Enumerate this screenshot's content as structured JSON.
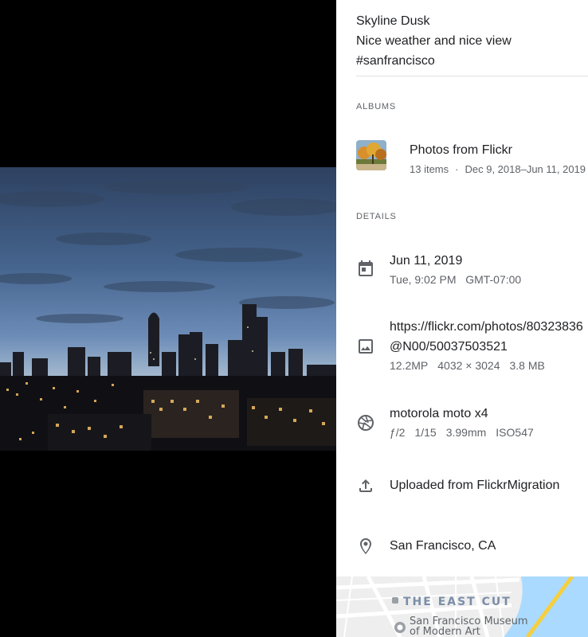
{
  "description": {
    "title": "Skyline Dusk",
    "caption": "Nice weather and nice view",
    "tags": "#sanfrancisco"
  },
  "albums": {
    "heading": "ALBUMS",
    "items": [
      {
        "title": "Photos from Flickr",
        "count": "13 items",
        "date_range": "Dec 9, 2018–Jun 11, 2019"
      }
    ]
  },
  "details": {
    "heading": "DETAILS",
    "date": {
      "icon": "calendar-icon",
      "primary": "Jun 11, 2019",
      "secondary": "Tue, 9:02 PM   GMT-07:00"
    },
    "file": {
      "icon": "image-icon",
      "url_line1": "https://flickr.com/photos/80323836",
      "url_line2": "@N00/50037503521",
      "megapixels": "12.2MP",
      "dimensions": "4032 × 3024",
      "size": "3.8 MB"
    },
    "camera": {
      "icon": "aperture-icon",
      "model": "motorola moto x4",
      "aperture": "ƒ/2",
      "shutter": "1/15",
      "focal": "3.99mm",
      "iso": "ISO547"
    },
    "upload": {
      "icon": "upload-icon",
      "text": "Uploaded from FlickrMigration"
    },
    "location": {
      "icon": "location-pin-icon",
      "text": "San Francisco, CA"
    }
  },
  "map": {
    "neighborhood": "THE EAST CUT",
    "poi_line1": "San Francisco Museum",
    "poi_line2": "of Modern Art"
  },
  "colors": {
    "text_primary": "#202124",
    "text_secondary": "#5f6368",
    "icon": "#5f6368",
    "divider": "#e0e0e0",
    "map_water": "#aadaff",
    "map_land": "#eeeeee"
  }
}
